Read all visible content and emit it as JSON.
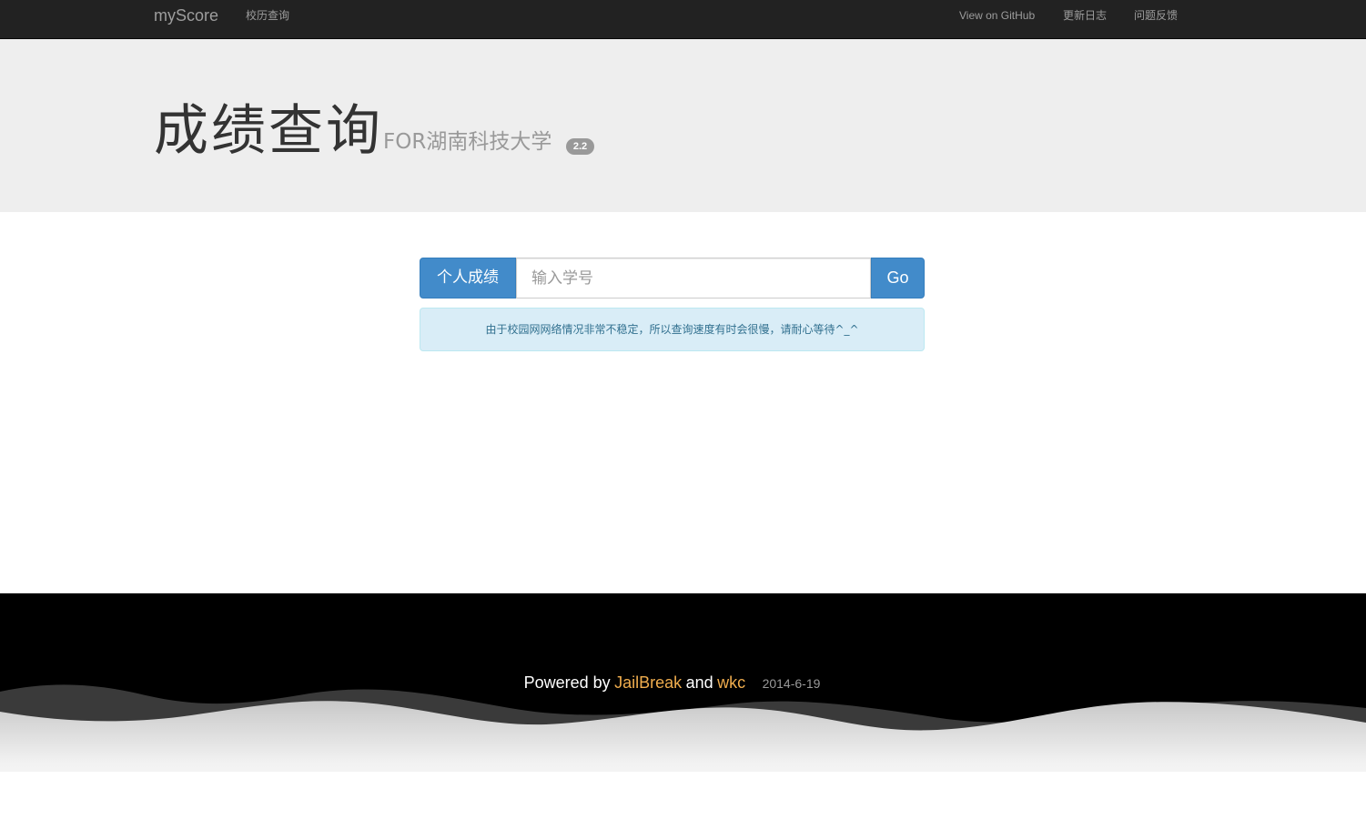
{
  "navbar": {
    "brand": "myScore",
    "left_links": [
      {
        "label": "校历查询"
      }
    ],
    "right_links": [
      {
        "label": "View on GitHub"
      },
      {
        "label": "更新日志"
      },
      {
        "label": "问题反馈"
      }
    ]
  },
  "header": {
    "title": "成绩查询",
    "subtitle": "FOR湖南科技大学",
    "version": "2.2"
  },
  "search": {
    "mode_label": "个人成绩",
    "placeholder": "输入学号",
    "value": "",
    "go_label": "Go"
  },
  "notice": {
    "text": "由于校园网网络情况非常不稳定，所以查询速度有时会很慢，请耐心等待^_^"
  },
  "footer": {
    "prefix": "Powered by",
    "author1": "JailBreak",
    "conjunction": "and",
    "author2": "wkc",
    "date": "2014-6-19"
  },
  "colors": {
    "navbar_bg": "#222222",
    "jumbotron_bg": "#eeeeee",
    "primary": "#428bca",
    "info_bg": "#d9edf7",
    "info_text": "#31708f",
    "footer_link": "#f0ad4e"
  }
}
